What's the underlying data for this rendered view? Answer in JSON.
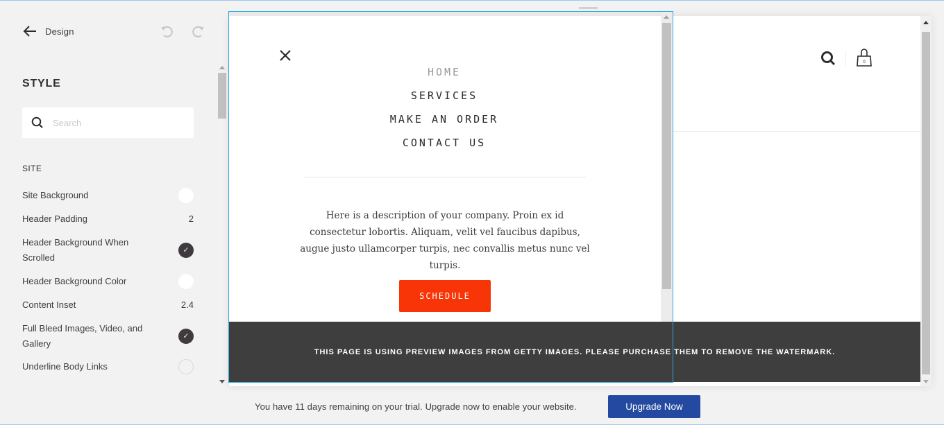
{
  "sidebar": {
    "back_label": "Design",
    "title": "STYLE",
    "search": {
      "placeholder": "Search",
      "value": ""
    },
    "section": "SITE",
    "options": [
      {
        "label": "Site Background",
        "type": "color",
        "value": "#ffffff"
      },
      {
        "label": "Header Padding",
        "type": "number",
        "value": "2"
      },
      {
        "label": "Header Background When Scrolled",
        "type": "toggle",
        "checked": true
      },
      {
        "label": "Header Background Color",
        "type": "color",
        "value": "#ffffff"
      },
      {
        "label": "Content Inset",
        "type": "number",
        "value": "2.4"
      },
      {
        "label": "Full Bleed Images, Video, and Gallery",
        "type": "toggle",
        "checked": true
      },
      {
        "label": "Underline Body Links",
        "type": "toggle",
        "checked": false
      }
    ],
    "icons": {
      "back": "arrow-left-icon",
      "undo": "undo-icon",
      "redo": "redo-icon",
      "search": "search-icon",
      "check": "✓"
    }
  },
  "preview": {
    "mobile_menu": {
      "nav": [
        "HOME",
        "SERVICES",
        "MAKE AN ORDER",
        "CONTACT US"
      ],
      "active_nav": "HOME",
      "description": "Here is a description of your company. Proin ex id consectetur lobortis. Aliquam, velit vel faucibus dapibus, augue justo ullamcorper turpis, nec convallis metus nunc vel turpis.",
      "cta_label": "SCHEDULE",
      "cta_color": "#f73506"
    },
    "header": {
      "cart_count": "0"
    },
    "watermark_notice": "THIS PAGE IS USING PREVIEW IMAGES FROM GETTY IMAGES. PLEASE PURCHASE THEM TO REMOVE THE WATERMARK.",
    "selection_color": "#29a8e0"
  },
  "trial": {
    "message": "You have 11 days remaining on your trial. Upgrade now to enable your website.",
    "upgrade_label": "Upgrade Now",
    "upgrade_color": "#2349a0"
  }
}
